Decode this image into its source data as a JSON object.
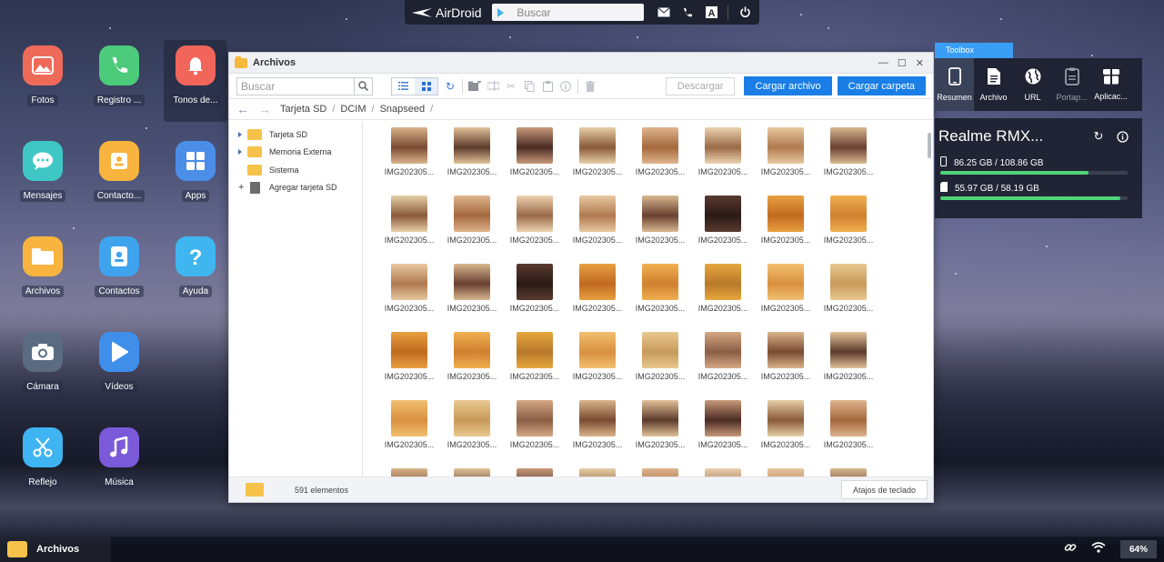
{
  "topbar": {
    "brand": "AirDroid",
    "search_placeholder": "Buscar"
  },
  "desktop_icons": [
    {
      "label": "Fotos",
      "color": "#f06a5a",
      "icon": "photo-icon"
    },
    {
      "label": "Registro ...",
      "color": "#4ccb7a",
      "icon": "phone-icon"
    },
    {
      "label": "Tonos de...",
      "color": "#f2655a",
      "icon": "bell-icon"
    },
    {
      "label": "Mensajes",
      "color": "#3fc7c6",
      "icon": "chat-icon"
    },
    {
      "label": "Contacto...",
      "color": "#f8b43e",
      "icon": "contact-card-icon"
    },
    {
      "label": "Apps",
      "color": "#4a8ee8",
      "icon": "apps-grid-icon"
    },
    {
      "label": "Archivos",
      "color": "#f8b43e",
      "icon": "folder-icon"
    },
    {
      "label": "Contactos",
      "color": "#3fa3ee",
      "icon": "contacts-icon"
    },
    {
      "label": "Ayuda",
      "color": "#3fb6f0",
      "icon": "help-icon"
    },
    {
      "label": "Cámara",
      "color": "#5a6b82",
      "icon": "camera-icon"
    },
    {
      "label": "Vídeos",
      "color": "#3f8eea",
      "icon": "play-icon"
    },
    {
      "label": "Reflejo",
      "color": "#3fb4f2",
      "icon": "scissors-icon"
    },
    {
      "label": "Música",
      "color": "#7a5ad8",
      "icon": "music-icon"
    }
  ],
  "window": {
    "title": "Archivos",
    "search_placeholder": "Buscar",
    "download_label": "Descargar",
    "upload_file_label": "Cargar archivo",
    "upload_folder_label": "Cargar carpeta",
    "breadcrumb": [
      "Tarjeta SD",
      "DCIM",
      "Snapseed"
    ],
    "tree": [
      {
        "label": "Tarjeta SD",
        "type": "folder"
      },
      {
        "label": "Memoria Externa",
        "type": "folder"
      },
      {
        "label": "Sistema",
        "type": "folder"
      },
      {
        "label": "Agregar tarjeta SD",
        "type": "add"
      }
    ],
    "file_name": "IMG202305...",
    "item_count": "591 elementos",
    "shortcuts_label": "Atajos de teclado"
  },
  "toolbox": {
    "tab": "Toolbox",
    "items": [
      {
        "label": "Resumen",
        "icon": "phone-device-icon"
      },
      {
        "label": "Archivo",
        "icon": "file-icon"
      },
      {
        "label": "URL",
        "icon": "globe-icon"
      },
      {
        "label": "Portap...",
        "icon": "clipboard-icon"
      },
      {
        "label": "Aplicac...",
        "icon": "package-icon"
      }
    ],
    "device_name": "Realme RMX...",
    "storage": [
      {
        "text": "86.25 GB / 108.86 GB",
        "fraction": 0.79
      },
      {
        "text": "55.97 GB / 58.19 GB",
        "fraction": 0.96
      }
    ]
  },
  "taskbar": {
    "active_app": "Archivos",
    "battery": "64%"
  },
  "colors": {
    "accent": "#1a7ee6",
    "toolbox_tab": "#3a9ef5",
    "storage_fill": "#4fd47a",
    "folder": "#f6c24a"
  }
}
